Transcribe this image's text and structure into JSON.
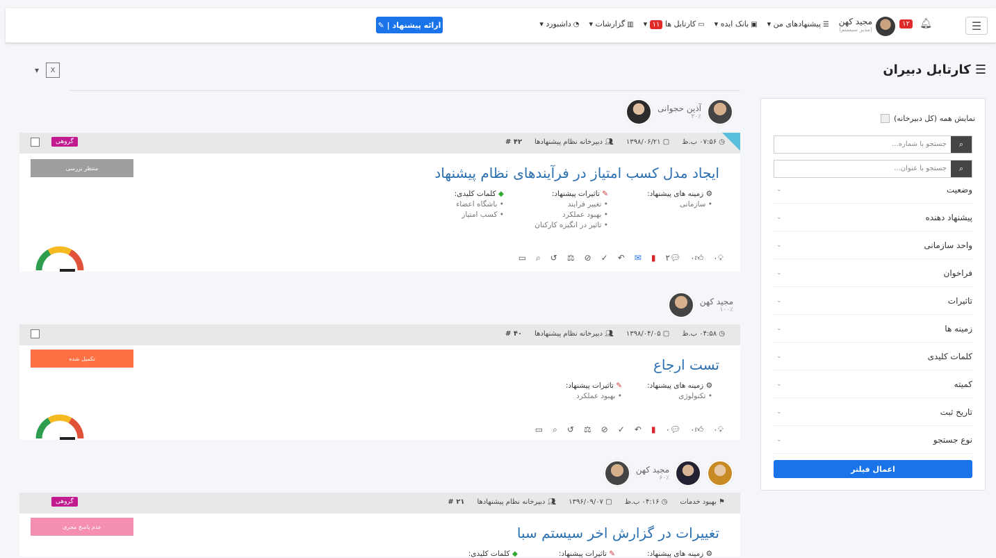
{
  "topbar": {
    "user_name": "مجید کهن",
    "user_role": "(مدیر سیستم)",
    "notif_count": "۱۲",
    "menu": [
      "داشبورد",
      "گزارشات",
      "کارتابل ها",
      "بانک ایده",
      "پیشنهادهای من"
    ],
    "kartabl_badge": "۱۱",
    "new_button": "ارائه پیشنهاد"
  },
  "page": {
    "title": "کارتابل دبیران",
    "export_caret": "▾"
  },
  "filters": {
    "show_all": "نمایش همه (کل دبیرخانه)",
    "search_number": "جستجو با شماره...",
    "search_title": "جستجو با عنوان...",
    "facets": [
      "وضعیت",
      "پیشنهاد دهنده",
      "واحد سازمانی",
      "فراخوان",
      "تاثیرات",
      "زمینه ها",
      "کلمات کلیدی",
      "کمیته",
      "تاریخ ثبت",
      "نوع جستجو"
    ],
    "apply": "اعمال فیلتر"
  },
  "cards": [
    {
      "users": [
        {
          "name": "آذین حجوانی",
          "pct": "۲۰٪"
        }
      ],
      "number": "۴۲ #",
      "secretariat": "دبیرخانه نظام پیشنهادها",
      "date": "۱۳۹۸/۰۶/۲۱",
      "time": "۰۷:۵۶ ب.ظ",
      "group": "گروهی",
      "status": "منتظر بررسی",
      "status_color": "#9e9e9e",
      "title": "ایجاد مدل کسب امتیاز در فرآیندهای نظام پیشنهاد",
      "keywords_label": "کلمات کلیدی:",
      "keywords": [
        "باشگاه اعضاء",
        "کسب امتیاز"
      ],
      "effects_label": "تاثیرات پیشنهاد:",
      "effects": [
        "تغییر فرایند",
        "بهبود عملکرد",
        "تاثیر در انگیزه کارکنان"
      ],
      "fields_label": "زمینه های پیشنهاد:",
      "fields": [
        "سازمانی"
      ],
      "counts": {
        "ideas": "۰",
        "likes": "۰",
        "comments": "۲"
      }
    },
    {
      "users": [
        {
          "name": "مجید کهن",
          "pct": "۱۰۰٪"
        }
      ],
      "number": "۴۰ #",
      "secretariat": "دبیرخانه نظام پیشنهادها",
      "date": "۱۳۹۸/۰۴/۰۵",
      "time": "۰۴:۵۸ ب.ظ",
      "group": "",
      "status": "تکمیل شده",
      "status_color": "#ff7043",
      "title": "تست ارجاع",
      "effects_label": "تاثیرات پیشنهاد:",
      "effects": [
        "بهبود عملکرد"
      ],
      "fields_label": "زمینه های پیشنهاد:",
      "fields": [
        "تکنولوژی"
      ],
      "counts": {
        "ideas": "۰",
        "likes": "۰",
        "comments": "۰"
      }
    },
    {
      "users": [
        {
          "name": "مجید کهن",
          "pct": "۶۰٪"
        }
      ],
      "number": "۲۱ #",
      "secretariat": "دبیرخانه نظام پیشنهادها",
      "date": "۱۳۹۶/۰۹/۰۷",
      "time": "۰۴:۱۶ ب.ظ",
      "extra": "بهبود خدمات",
      "group": "گروهی",
      "status": "عدم پاسخ مجری",
      "status_color": "#f48fb1",
      "title": "تغییرات در گزارش اخر سیستم سبا",
      "keywords_label": "کلمات کلیدی:",
      "effects_label": "تاثیرات پیشنهاد:",
      "fields_label": "زمینه های پیشنهاد:"
    }
  ]
}
